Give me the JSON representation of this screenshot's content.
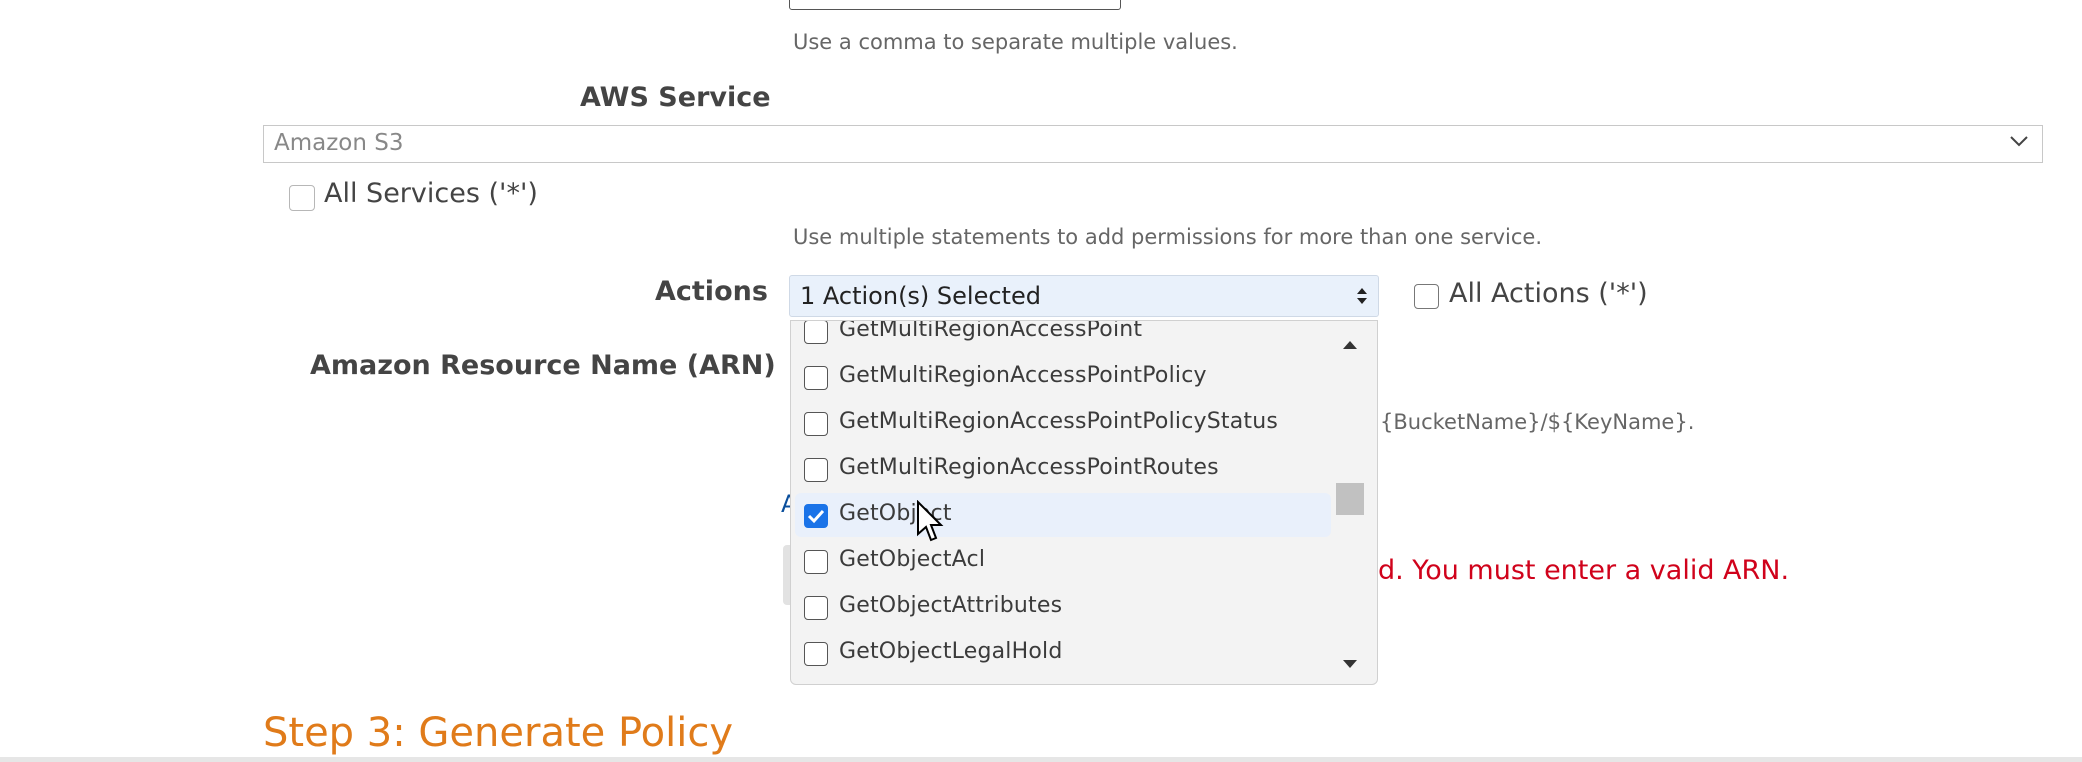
{
  "top": {
    "hint": "Use a comma to separate multiple values."
  },
  "service": {
    "label": "AWS Service",
    "selected": "Amazon S3",
    "all_services_label": "All Services ('*')",
    "hint": "Use multiple statements to add permissions for more than one service."
  },
  "actions": {
    "label": "Actions",
    "selected_text": "1 Action(s) Selected",
    "all_actions_label": "All Actions ('*')",
    "options": [
      {
        "label": "GetMultiRegionAccessPoint",
        "checked": false
      },
      {
        "label": "GetMultiRegionAccessPointPolicy",
        "checked": false
      },
      {
        "label": "GetMultiRegionAccessPointPolicyStatus",
        "checked": false
      },
      {
        "label": "GetMultiRegionAccessPointRoutes",
        "checked": false
      },
      {
        "label": "GetObject",
        "checked": true
      },
      {
        "label": "GetObjectAcl",
        "checked": false
      },
      {
        "label": "GetObjectAttributes",
        "checked": false
      },
      {
        "label": "GetObjectLegalHold",
        "checked": false
      }
    ]
  },
  "arn": {
    "label": "Amazon Resource Name (ARN)",
    "hint_fragment": "{BucketName}/${KeyName}.",
    "link_fragment": "A",
    "error_fragment": "d. You must enter a valid ARN."
  },
  "step3": {
    "title": "Step 3: Generate Policy"
  },
  "colors": {
    "step_heading": "#e07b1a",
    "error": "#d0021b",
    "checked": "#1a73e8"
  }
}
